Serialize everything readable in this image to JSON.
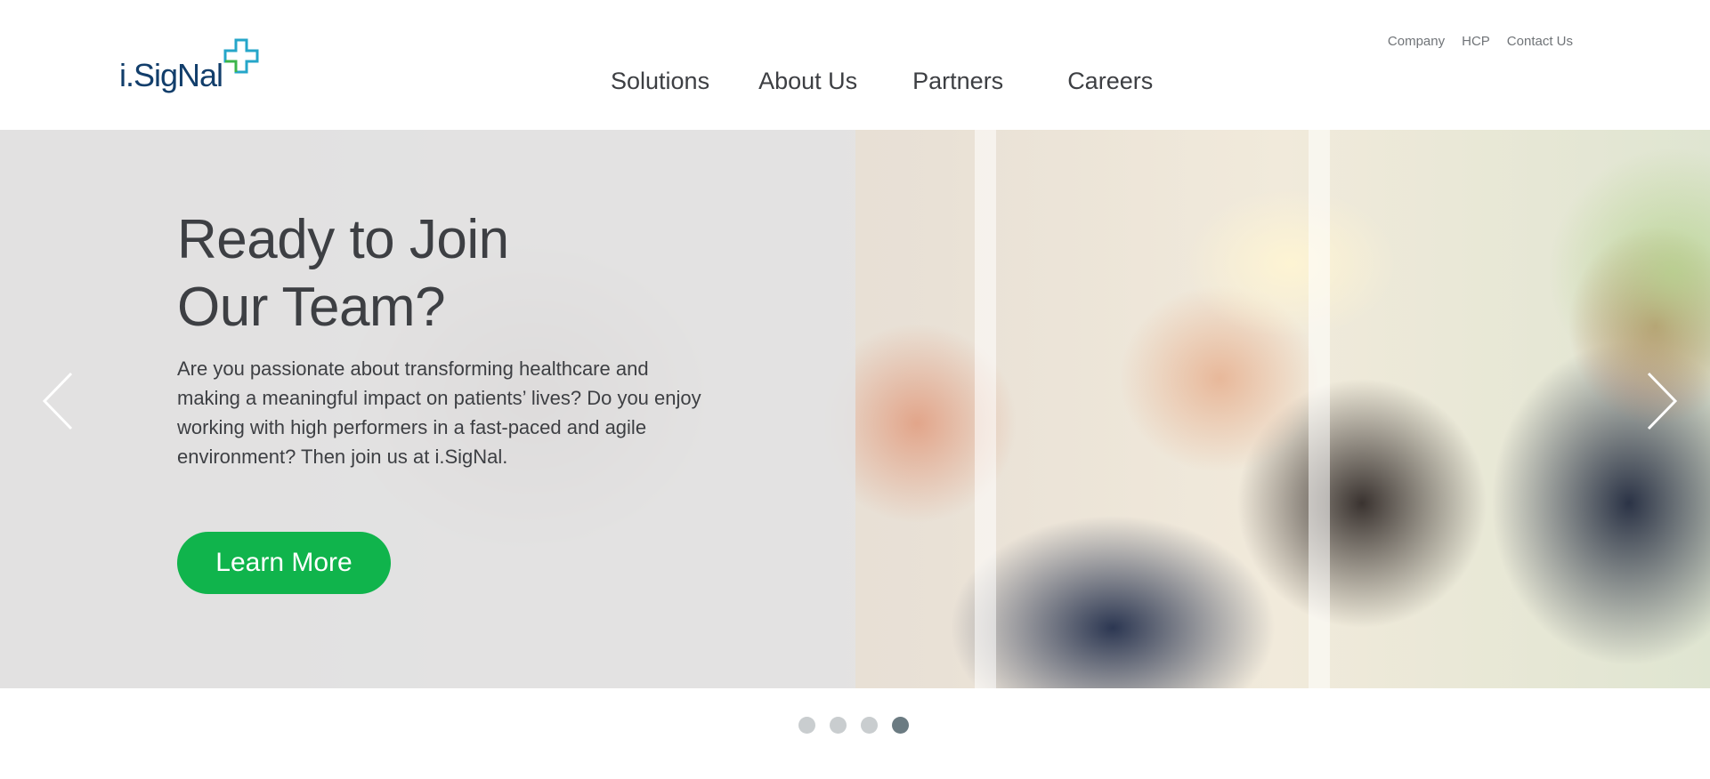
{
  "brand": {
    "logo_text": "i.SigNal",
    "primary_color": "#123e6b",
    "accent_color": "#10b44c"
  },
  "top_links": [
    "Company",
    "HCP",
    "Contact Us"
  ],
  "main_nav": [
    "Solutions",
    "About Us",
    "Partners",
    "Careers"
  ],
  "hero": {
    "title": "Ready to Join\nOur Team?",
    "body": "Are you passionate about transforming healthcare and making a meaningful impact on patients’ lives? Do you enjoy working with high performers in a fast-paced and agile environment? Then join us at i.SigNal.",
    "cta_label": "Learn More",
    "prev_icon": "chevron-left-icon",
    "next_icon": "chevron-right-icon"
  },
  "carousel": {
    "slide_count": 4,
    "active_index": 3
  }
}
